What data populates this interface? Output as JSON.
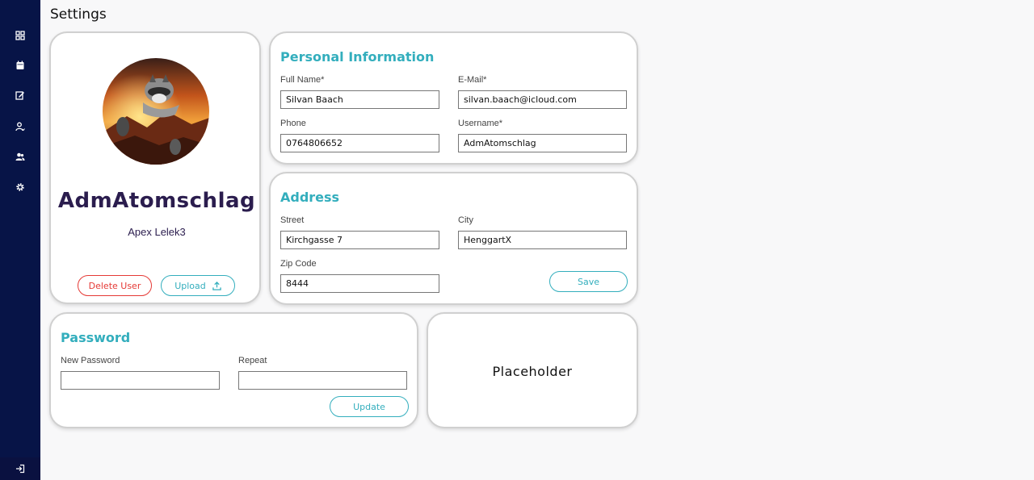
{
  "page": {
    "title": "Settings"
  },
  "sidebar": {
    "items": [
      {
        "icon": "dashboard-grid-icon"
      },
      {
        "icon": "calendar-icon"
      },
      {
        "icon": "edit-note-icon"
      },
      {
        "icon": "user-icon"
      },
      {
        "icon": "users-group-icon"
      },
      {
        "icon": "settings-gear-icon"
      }
    ],
    "logout_icon": "logout-icon"
  },
  "profile": {
    "username": "AdmAtomschlag",
    "subtitle": "Apex Lelek3",
    "delete_label": "Delete User",
    "upload_label": "Upload"
  },
  "personal": {
    "title": "Personal Information",
    "full_name_label": "Full Name*",
    "full_name": "Silvan Baach",
    "email_label": "E-Mail*",
    "email": "silvan.baach@icloud.com",
    "phone_label": "Phone",
    "phone": "0764806652",
    "username_label": "Username*",
    "username": "AdmAtomschlag"
  },
  "address": {
    "title": "Address",
    "street_label": "Street",
    "street": "Kirchgasse 7",
    "city_label": "City",
    "city": "HenggartX",
    "zip_label": "Zip Code",
    "zip": "8444",
    "save_label": "Save"
  },
  "password": {
    "title": "Password",
    "new_label": "New Password",
    "new_value": "",
    "repeat_label": "Repeat",
    "repeat_value": "",
    "update_label": "Update"
  },
  "placeholder": {
    "text": "Placeholder"
  },
  "colors": {
    "sidebar": "#071447",
    "accent": "#33aebd",
    "danger": "#e53935",
    "name": "#2b1d4e"
  }
}
